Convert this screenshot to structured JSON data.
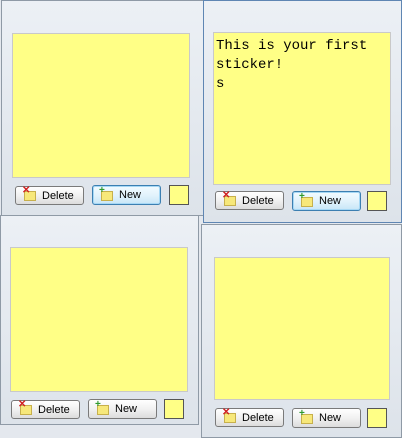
{
  "colors": {
    "sticker": "#ffff86",
    "panel": "#e6eaf0"
  },
  "labels": {
    "delete": "Delete",
    "new": "New"
  },
  "stickers": [
    {
      "text": ""
    },
    {
      "text": "This is your first\nsticker!\ns"
    },
    {
      "text": ""
    },
    {
      "text": ""
    }
  ],
  "icons": {
    "delete": "delete-note-icon",
    "new": "new-note-icon"
  }
}
